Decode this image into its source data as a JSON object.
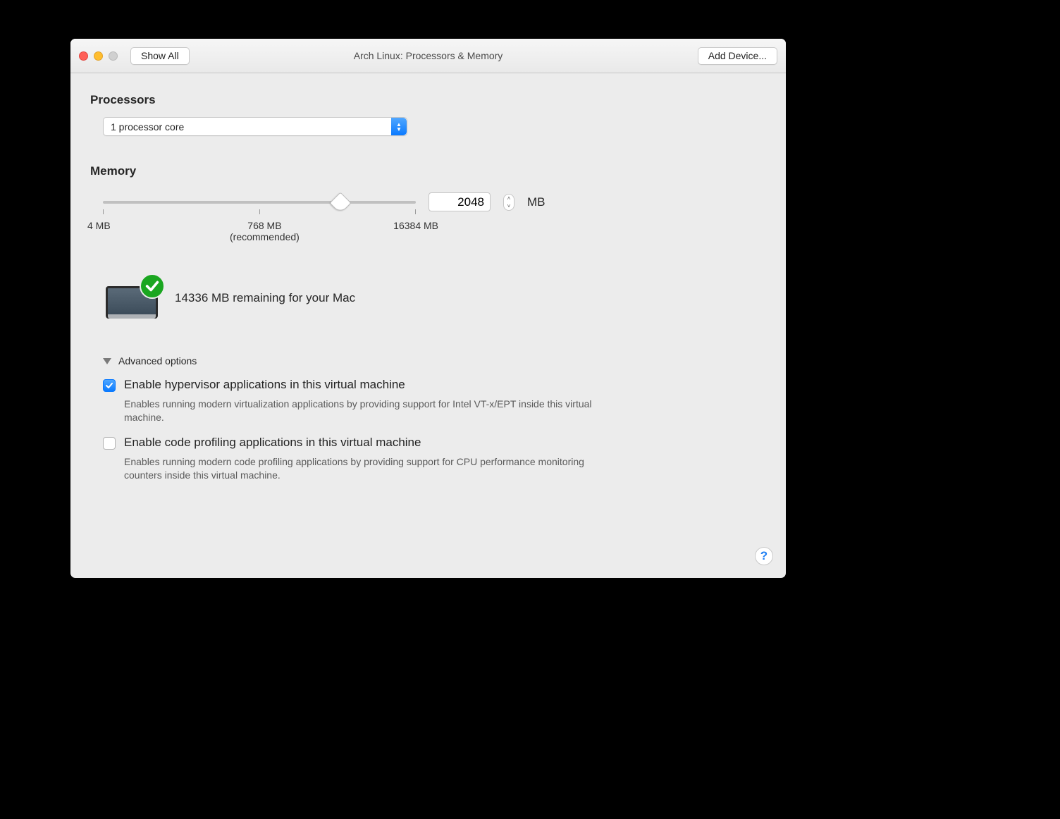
{
  "titlebar": {
    "show_all": "Show All",
    "title": "Arch Linux: Processors & Memory",
    "add_device": "Add Device..."
  },
  "processors": {
    "heading": "Processors",
    "selected": "1 processor core"
  },
  "memory": {
    "heading": "Memory",
    "value": "2048",
    "unit": "MB",
    "min_label": "4 MB",
    "recommended_label": "768 MB",
    "recommended_sub": "(recommended)",
    "max_label": "16384 MB",
    "remaining": "14336 MB remaining for your Mac"
  },
  "advanced": {
    "heading": "Advanced options",
    "hypervisor": {
      "label": "Enable hypervisor applications in this virtual machine",
      "desc": "Enables running modern virtualization applications by providing support for Intel VT-x/EPT inside this virtual machine."
    },
    "profiling": {
      "label": "Enable code profiling applications in this virtual machine",
      "desc": "Enables running modern code profiling applications by providing support for CPU performance monitoring counters inside this virtual machine."
    }
  },
  "help": "?"
}
